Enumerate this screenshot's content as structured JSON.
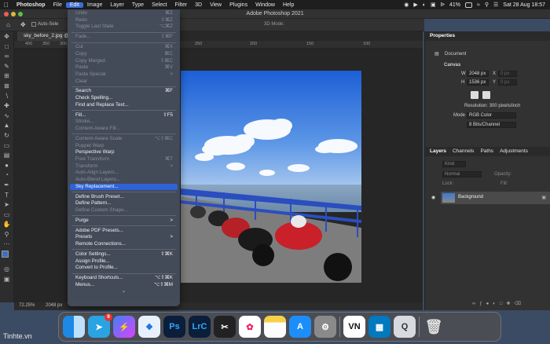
{
  "menubar": {
    "app": "Photoshop",
    "items": [
      "File",
      "Edit",
      "Image",
      "Layer",
      "Type",
      "Select",
      "Filter",
      "3D",
      "View",
      "Plugins",
      "Window",
      "Help"
    ],
    "battery": "41%",
    "datetime": "Sat 28 Aug 18:57"
  },
  "window": {
    "title": "Adobe Photoshop 2021"
  },
  "options": {
    "auto_select": "Auto-Sele",
    "mode_3d": "3D Mode:"
  },
  "document": {
    "tab": "sky_before_2.jpg @",
    "zoom": "72.25%",
    "size": "2048 px"
  },
  "ruler": [
    "400",
    "350",
    "300",
    "250",
    "200",
    "150",
    "100"
  ],
  "edit_menu": [
    {
      "label": "Undo",
      "shortcut": "⌘Z",
      "state": "dis"
    },
    {
      "label": "Redo",
      "shortcut": "⇧⌘Z",
      "state": "dis"
    },
    {
      "label": "Toggle Last State",
      "shortcut": "⌥⌘Z",
      "state": "dis"
    },
    {
      "sep": true
    },
    {
      "label": "Fade...",
      "shortcut": "⇧⌘F",
      "state": "dis"
    },
    {
      "sep": true
    },
    {
      "label": "Cut",
      "shortcut": "⌘X",
      "state": "dis"
    },
    {
      "label": "Copy",
      "shortcut": "⌘C",
      "state": "dis"
    },
    {
      "label": "Copy Merged",
      "shortcut": "⇧⌘C",
      "state": "dis"
    },
    {
      "label": "Paste",
      "shortcut": "⌘V",
      "state": "dis"
    },
    {
      "label": "Paste Special",
      "shortcut": ">",
      "state": "dis"
    },
    {
      "label": "Clear",
      "shortcut": "",
      "state": "dis"
    },
    {
      "sep": true
    },
    {
      "label": "Search",
      "shortcut": "⌘F",
      "state": "en"
    },
    {
      "label": "Check Spelling...",
      "shortcut": "",
      "state": "en"
    },
    {
      "label": "Find and Replace Text...",
      "shortcut": "",
      "state": "en"
    },
    {
      "sep": true
    },
    {
      "label": "Fill...",
      "shortcut": "⇧F5",
      "state": "en"
    },
    {
      "label": "Stroke...",
      "shortcut": "",
      "state": "dis"
    },
    {
      "label": "Content-Aware Fill...",
      "shortcut": "",
      "state": "dis"
    },
    {
      "sep": true
    },
    {
      "label": "Content-Aware Scale",
      "shortcut": "⌥⇧⌘C",
      "state": "dis"
    },
    {
      "label": "Puppet Warp",
      "shortcut": "",
      "state": "dis"
    },
    {
      "label": "Perspective Warp",
      "shortcut": "",
      "state": "en"
    },
    {
      "label": "Free Transform",
      "shortcut": "⌘T",
      "state": "dis"
    },
    {
      "label": "Transform",
      "shortcut": ">",
      "state": "dis"
    },
    {
      "label": "Auto-Align Layers...",
      "shortcut": "",
      "state": "dis"
    },
    {
      "label": "Auto-Blend Layers...",
      "shortcut": "",
      "state": "dis"
    },
    {
      "label": "Sky Replacement...",
      "shortcut": "",
      "state": "hl"
    },
    {
      "sep": true
    },
    {
      "label": "Define Brush Preset...",
      "shortcut": "",
      "state": "en"
    },
    {
      "label": "Define Pattern...",
      "shortcut": "",
      "state": "en"
    },
    {
      "label": "Define Custom Shape...",
      "shortcut": "",
      "state": "dis"
    },
    {
      "sep": true
    },
    {
      "label": "Purge",
      "shortcut": ">",
      "state": "en"
    },
    {
      "sep": true
    },
    {
      "label": "Adobe PDF Presets...",
      "shortcut": "",
      "state": "en"
    },
    {
      "label": "Presets",
      "shortcut": ">",
      "state": "en"
    },
    {
      "label": "Remote Connections...",
      "shortcut": "",
      "state": "en"
    },
    {
      "sep": true
    },
    {
      "label": "Color Settings...",
      "shortcut": "⇧⌘K",
      "state": "en"
    },
    {
      "label": "Assign Profile...",
      "shortcut": "",
      "state": "en"
    },
    {
      "label": "Convert to Profile...",
      "shortcut": "",
      "state": "en"
    },
    {
      "sep": true
    },
    {
      "label": "Keyboard Shortcuts...",
      "shortcut": "⌥⇧⌘K",
      "state": "en"
    },
    {
      "label": "Menus...",
      "shortcut": "⌥⇧⌘M",
      "state": "en"
    }
  ],
  "properties": {
    "title": "Properties",
    "doc_label": "Document",
    "canvas": "Canvas",
    "w_label": "W",
    "w": "2048 px",
    "h_label": "H",
    "h": "1536 px",
    "x_label": "X",
    "y_label": "Y",
    "x_ph": "0 px",
    "y_ph": "0 px",
    "resolution": "Resolution: 300 pixels/inch",
    "mode_label": "Mode",
    "mode": "RGB Color",
    "depth": "8 Bits/Channel"
  },
  "layers": {
    "tabs": [
      "Layers",
      "Channels",
      "Paths",
      "Adjustments"
    ],
    "kind": "Kind",
    "blend": "Normal",
    "opacity_label": "Opacity:",
    "lock_label": "Lock:",
    "fill_label": "Fill:",
    "layer_name": "Background"
  },
  "dock": [
    "Finder",
    "Telegram",
    "Messenger",
    "Safari",
    "Photoshop",
    "Lightroom Classic",
    "Final Cut Pro",
    "Photos",
    "Notes",
    "App Store",
    "System Preferences",
    "VN",
    "Trello",
    "QuickTime",
    "Trash"
  ],
  "dock_labels": {
    "ps": "Ps",
    "lrc": "LrC",
    "vn": "VN"
  },
  "dock_badge": "9",
  "watermark": "Tinhte.vn"
}
